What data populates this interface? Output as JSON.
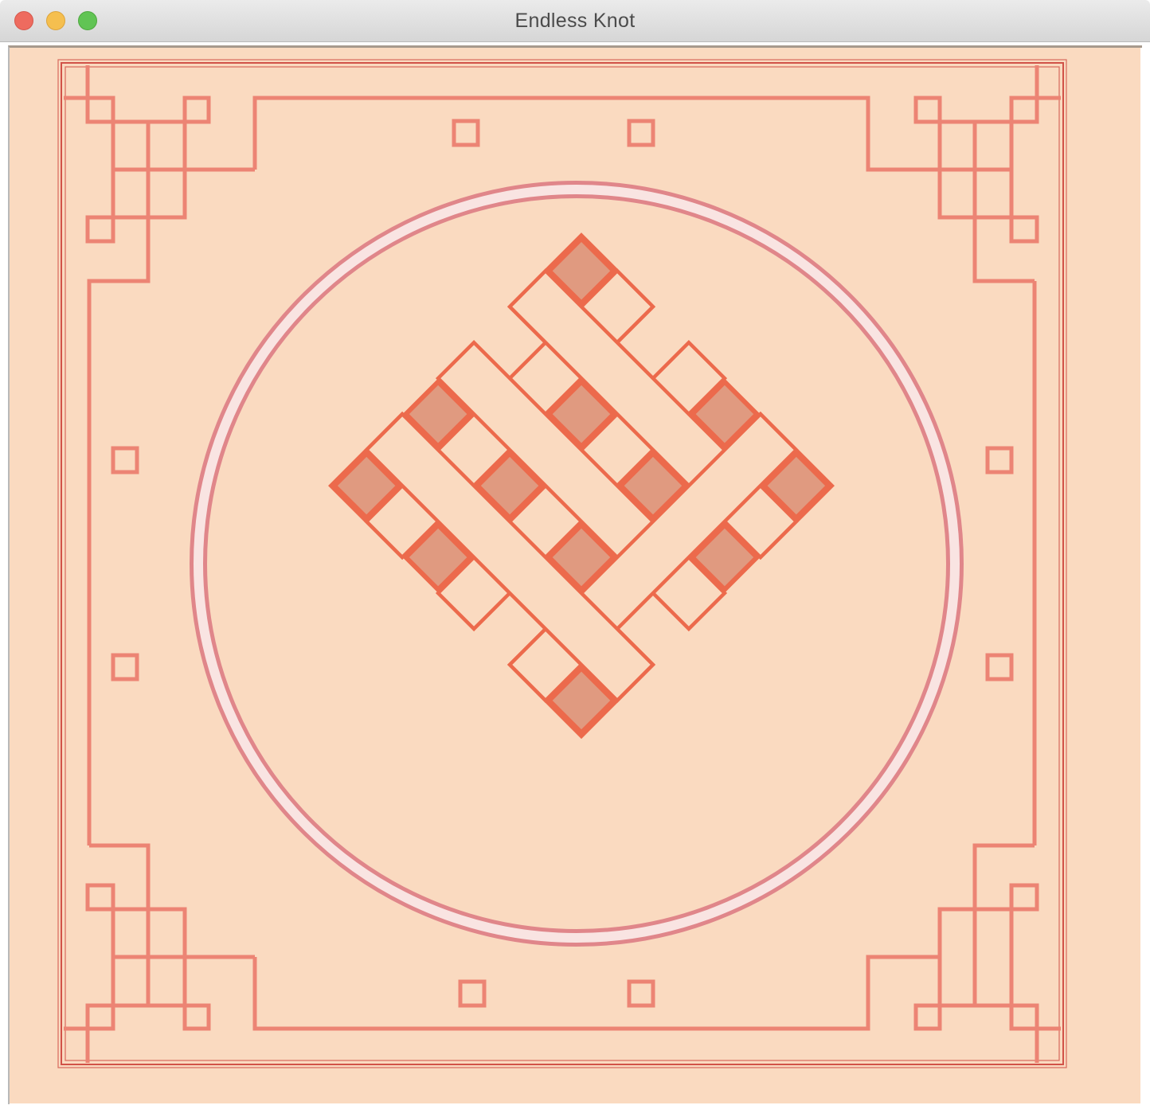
{
  "window": {
    "title": "Endless Knot",
    "buttons": {
      "close": "close-button",
      "minimize": "minimize-button",
      "zoom": "zoom-button"
    }
  },
  "colors": {
    "background": "#fadac0",
    "frame": "#c93a32",
    "lattice": "#ec8474",
    "ring_outer": "#e0868a",
    "ring_inner": "#f9e4e2",
    "knot_stroke": "#ec6a4c",
    "knot_fill": "#e09a80"
  },
  "icons": [
    "close-icon",
    "minimize-icon",
    "zoom-icon"
  ]
}
